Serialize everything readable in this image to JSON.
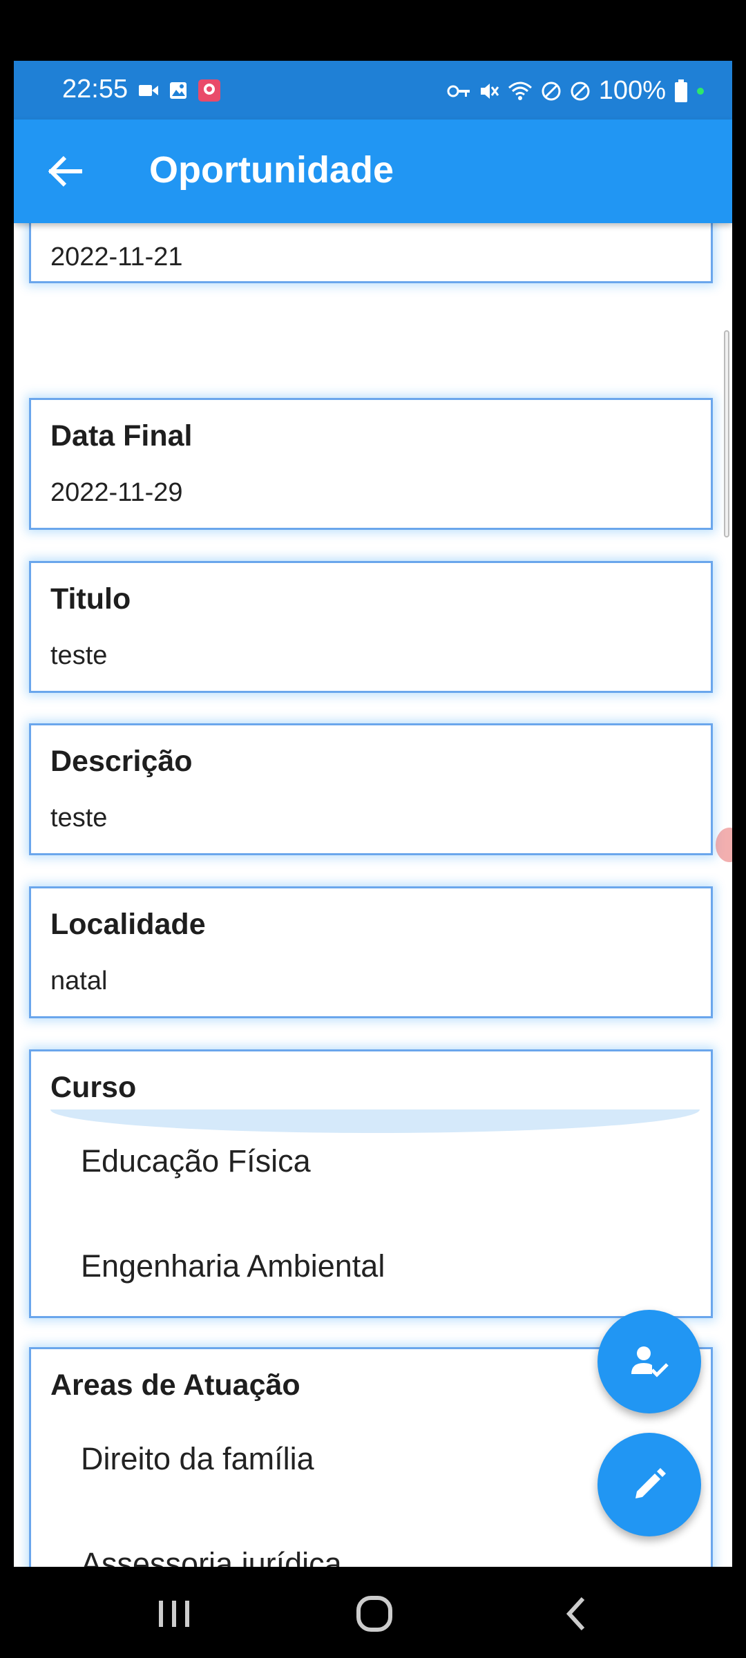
{
  "status_bar": {
    "time": "22:55",
    "battery": "100%",
    "icons_left": [
      "video-icon",
      "image-icon",
      "app-icon"
    ],
    "icons_right": [
      "key-icon",
      "mute-icon",
      "wifi-icon",
      "blocked-icon",
      "blocked-icon",
      "battery-icon"
    ]
  },
  "app_bar": {
    "title": "Oportunidade",
    "back_icon": "arrow-back-icon"
  },
  "cards": {
    "data_inicial": {
      "value": "2022-11-21"
    },
    "data_final": {
      "label": "Data Final",
      "value": "2022-11-29"
    },
    "titulo": {
      "label": "Titulo",
      "value": "teste"
    },
    "descricao": {
      "label": "Descrição",
      "value": "teste"
    },
    "localidade": {
      "label": "Localidade",
      "value": "natal"
    },
    "curso": {
      "label": "Curso",
      "items": [
        "Educação Física",
        "Engenharia Ambiental"
      ]
    },
    "areas": {
      "label": "Areas de Atuação",
      "items": [
        "Direito da família",
        "Assessoria jurídica"
      ]
    }
  },
  "fabs": {
    "apply_icon": "person-check-icon",
    "edit_icon": "edit-pencil-icon"
  },
  "colors": {
    "primary": "#2196f3",
    "status_bar": "#1f80d6",
    "card_border": "#6aa6ec"
  }
}
